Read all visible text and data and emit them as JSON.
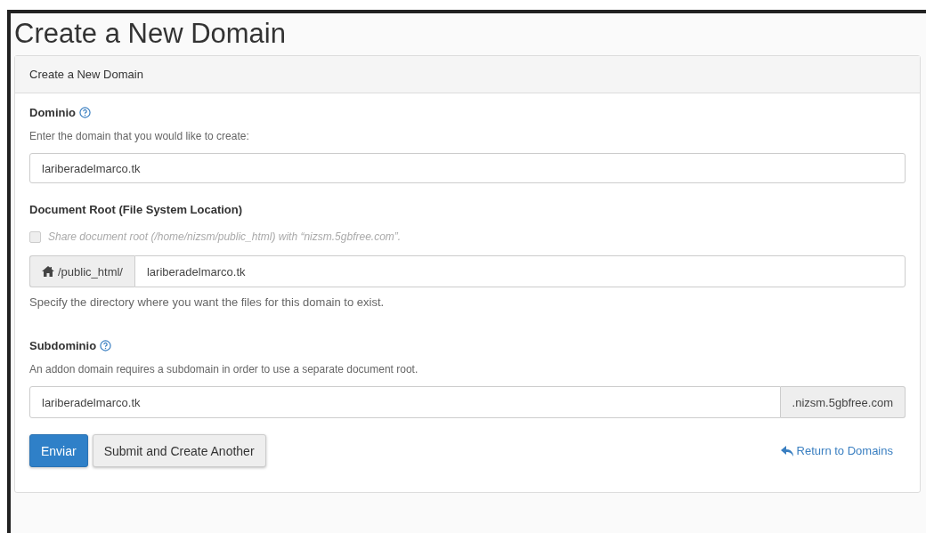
{
  "page": {
    "title": "Create a New Domain"
  },
  "panel": {
    "heading": "Create a New Domain",
    "domain": {
      "label": "Dominio",
      "hint": "Enter the domain that you would like to create:",
      "value": "lariberadelmarco.tk"
    },
    "document_root": {
      "label": "Document Root (File System Location)",
      "share_checkbox": {
        "label": "Share document root (/home/nizsm/public_html) with “nizsm.5gbfree.com”.",
        "checked": false,
        "disabled": true
      },
      "prefix": "/public_html/",
      "value": "lariberadelmarco.tk",
      "help": "Specify the directory where you want the files for this domain to exist."
    },
    "subdomain": {
      "label": "Subdominio",
      "hint": "An addon domain requires a subdomain in order to use a separate document root.",
      "value": "lariberadelmarco.tk",
      "suffix": ".nizsm.5gbfree.com"
    },
    "buttons": [
      {
        "label": "Enviar",
        "kind": "primary"
      },
      {
        "label": "Submit and Create Another",
        "kind": "default"
      }
    ],
    "return_link": "Return to Domains"
  }
}
